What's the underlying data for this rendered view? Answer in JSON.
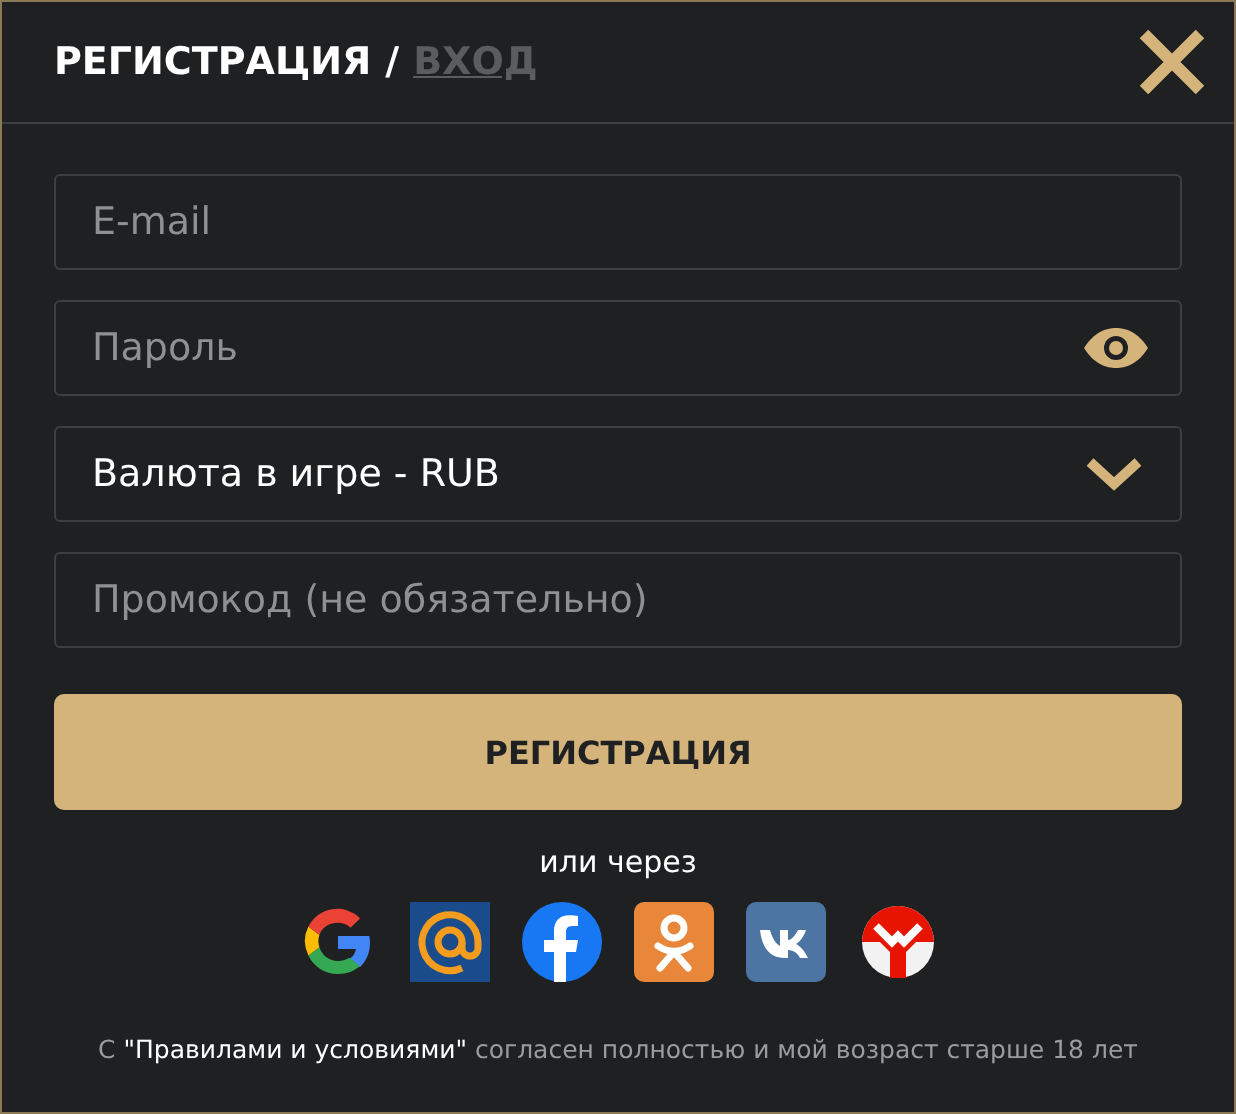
{
  "header": {
    "tabs": [
      {
        "label": "РЕГИСТРАЦИЯ",
        "selected": true
      },
      {
        "label": "ВХОД",
        "selected": false
      }
    ],
    "separator": "/"
  },
  "fields": [
    {
      "kind": "input",
      "placeholder": "E-mail"
    },
    {
      "kind": "password",
      "placeholder": "Пароль"
    },
    {
      "kind": "select",
      "value": "Валюта в игре - RUB"
    },
    {
      "kind": "input",
      "placeholder": "Промокод (не обязательно)"
    }
  ],
  "submit": "РЕГИСТРАЦИЯ",
  "social_caption": "или через",
  "social": [
    {
      "kind": "google"
    },
    {
      "kind": "mail"
    },
    {
      "kind": "facebook"
    },
    {
      "kind": "ok"
    },
    {
      "kind": "vk"
    },
    {
      "kind": "yandex"
    }
  ],
  "footer": {
    "prefix": "С",
    "link": "\"Правилами и условиями\"",
    "rest": "согласен полностью и мой возраст старше 18 лет"
  }
}
